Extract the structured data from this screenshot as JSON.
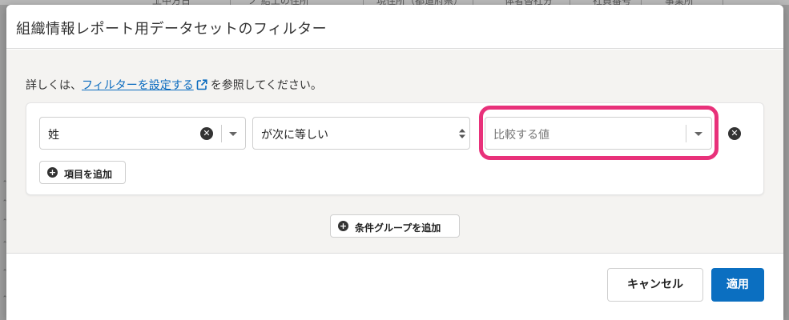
{
  "background": {
    "columns": [
      "上中方日",
      "ノ 結土の住所",
      "現住所（都道府県）",
      "体者替社分",
      "社員番号",
      "事業所"
    ],
    "row_marks": [
      "＾",
      "＾",
      "＾",
      "＾",
      "＾",
      "＾"
    ]
  },
  "dialog": {
    "title": "組織情報レポート用データセットのフィルター",
    "help_prefix": "詳しくは、",
    "help_link": "フィルターを設定する",
    "help_suffix": "を参照してください。",
    "help_link_icon": "external-link-icon",
    "filter_row": {
      "field_value": "姓",
      "operator_value": "が次に等しい",
      "compare_placeholder": "比較する値"
    },
    "add_item_label": "項目を追加",
    "add_group_label": "条件グループを追加",
    "cancel_label": "キャンセル",
    "apply_label": "適用"
  },
  "colors": {
    "primary": "#0b6fc1",
    "highlight": "#e8317a",
    "link": "#0a6bbf"
  }
}
